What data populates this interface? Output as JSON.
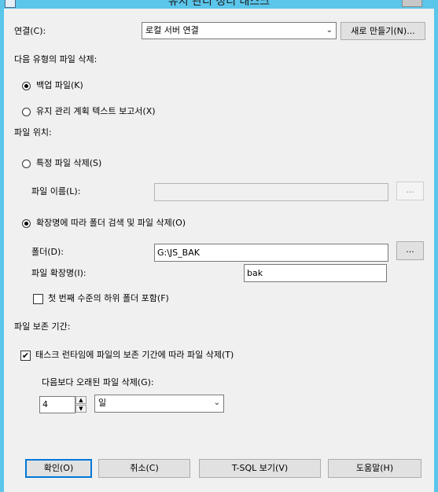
{
  "window": {
    "title": "유지 관리 정리 태스크"
  },
  "connection": {
    "label": "연결(C):",
    "selected": "로컬 서버 연결",
    "new_button": "새로 만들기(N)..."
  },
  "delete_type": {
    "heading": "다음 유형의 파일 삭제:",
    "options": [
      {
        "label": "백업 파일(K)",
        "selected": true
      },
      {
        "label": "유지 관리 계획 텍스트 보고서(X)",
        "selected": false
      }
    ]
  },
  "file_location": {
    "heading": "파일 위치:",
    "specific_file": {
      "label": "특정 파일 삭제(S)",
      "selected": false,
      "filename_label": "파일 이름(L):",
      "filename_value": "",
      "browse_label": "..."
    },
    "by_extension": {
      "label": "확장명에 따라 폴더 검색 및 파일 삭제(O)",
      "selected": true,
      "folder_label": "폴더(D):",
      "folder_value": "G:\\JS_BAK",
      "browse_label": "...",
      "extension_label": "파일 확장명(I):",
      "extension_value": "bak",
      "subfolder_label": "첫 번째 수준의 하위 폴더 포함(F)",
      "subfolder_checked": false
    }
  },
  "retention": {
    "heading": "파일 보존 기간:",
    "checkbox_label": "태스크 런타임에 파일의 보존 기간에 따라 파일 삭제(T)",
    "checked": true,
    "older_than_label": "다음보다 오래된 파일 삭제(G):",
    "amount": "4",
    "unit": "일"
  },
  "buttons": {
    "ok": "확인(O)",
    "cancel": "취소(C)",
    "tsql": "T-SQL 보기(V)",
    "help": "도움말(H)"
  },
  "icons": {
    "window": "window-icon",
    "chevron": "chevron-down-icon",
    "check": "checkmark-icon"
  }
}
